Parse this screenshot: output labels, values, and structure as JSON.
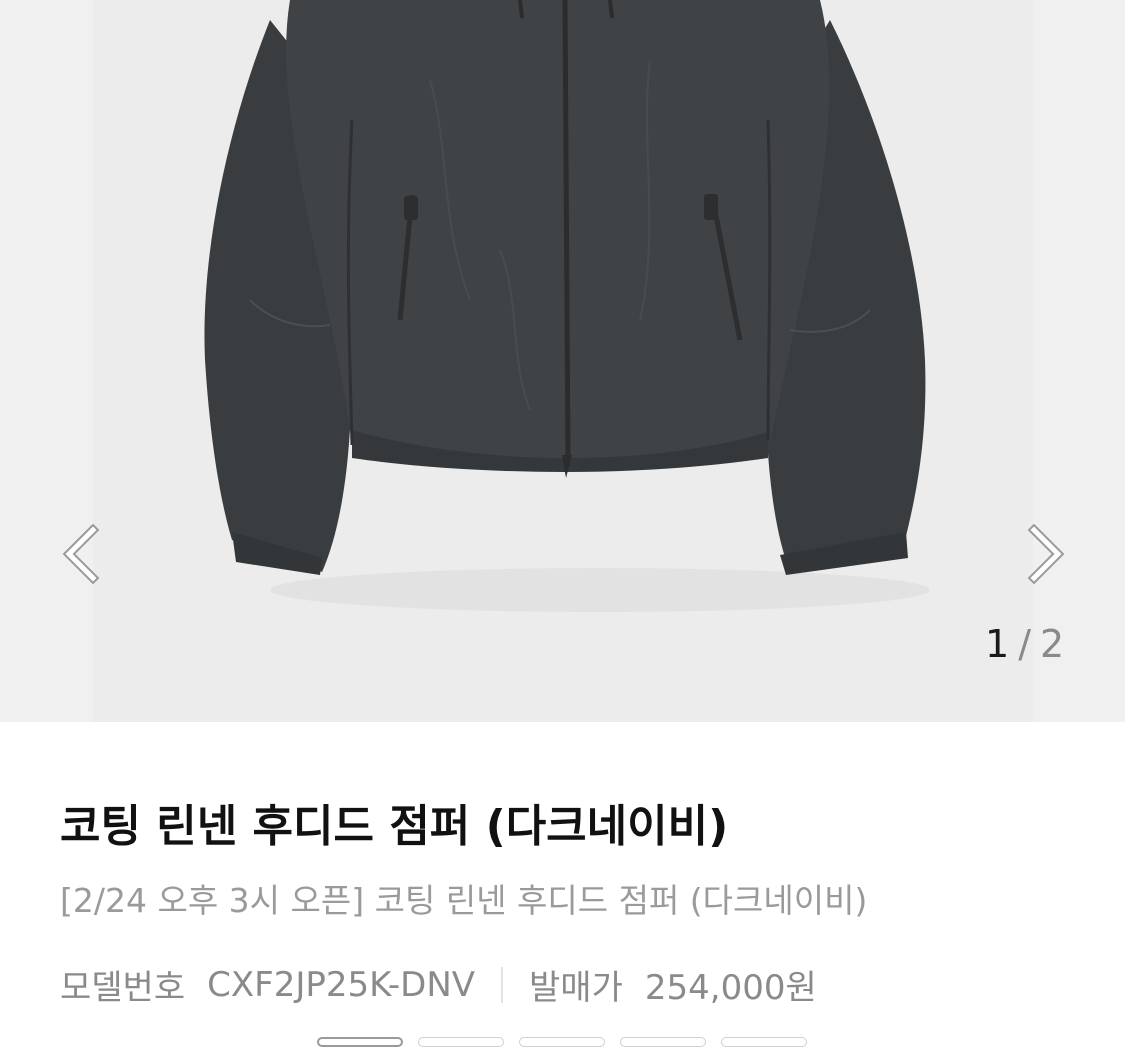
{
  "gallery": {
    "current_page": "1",
    "separator": "/",
    "total_pages": "2",
    "prev_icon": "chevron-left-icon",
    "next_icon": "chevron-right-icon"
  },
  "product": {
    "title": "코팅 린넨 후디드 점퍼 (다크네이비)",
    "subtitle": "[2/24 오후 3시 오픈] 코팅 린넨 후디드 점퍼 (다크네이비)",
    "model_label": "모델번호",
    "model_number": "CXF2JP25K-DNV",
    "price_label": "발매가",
    "price": "254,000원"
  },
  "indicators": {
    "count": 5,
    "active_index": 0
  },
  "colors": {
    "jacket": "#3b3e41",
    "background": "#ececec"
  }
}
